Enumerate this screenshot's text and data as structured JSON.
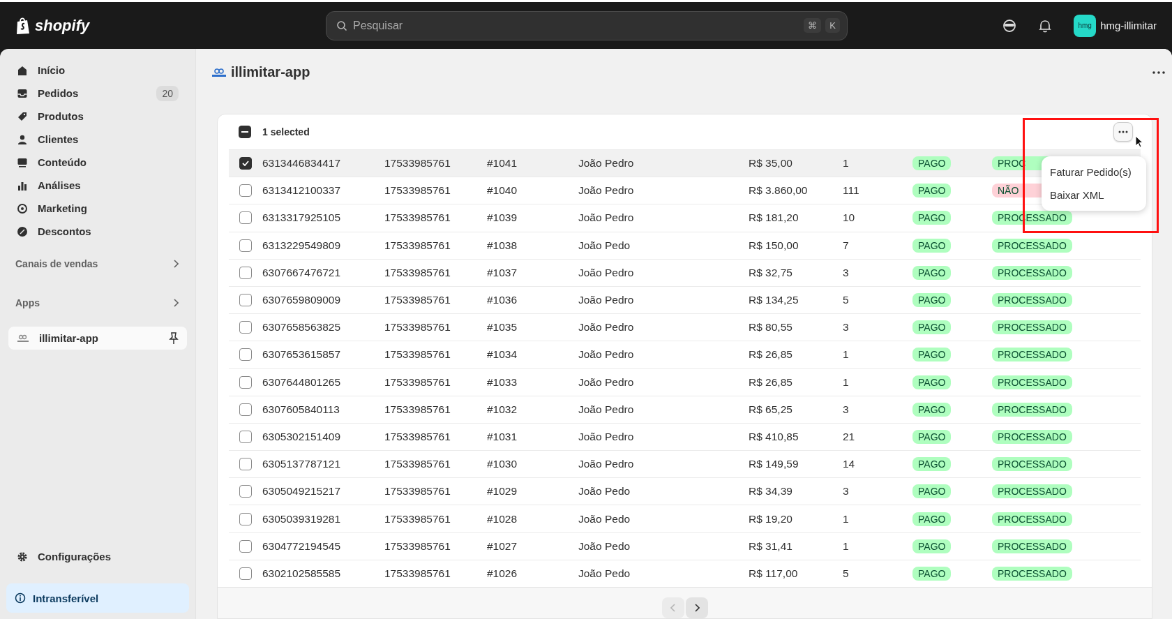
{
  "topbar": {
    "logo": "shopify",
    "search": {
      "placeholder": "Pesquisar",
      "keys": [
        "⌘",
        "K"
      ]
    },
    "account": {
      "avatar": "hmg",
      "name": "hmg-illimitar"
    }
  },
  "sidebar": {
    "items": [
      {
        "label": "Início",
        "selected": false
      },
      {
        "label": "Pedidos",
        "selected": false,
        "badge": "20"
      },
      {
        "label": "Produtos",
        "selected": false
      },
      {
        "label": "Clientes",
        "selected": false
      },
      {
        "label": "Conteúdo",
        "selected": false
      },
      {
        "label": "Análises",
        "selected": false
      },
      {
        "label": "Marketing",
        "selected": false
      },
      {
        "label": "Descontos",
        "selected": false
      }
    ],
    "sections": [
      {
        "label": "Canais de vendas"
      },
      {
        "label": "Apps",
        "items": [
          {
            "label": "illimitar-app",
            "selected": true,
            "pinned": true
          }
        ]
      }
    ],
    "settings": "Configurações",
    "notice": "Intransferível"
  },
  "page": {
    "title": "illimitar-app"
  },
  "table": {
    "bulk": {
      "label": "1 selected",
      "indeterminate": true
    },
    "menu": {
      "open": true,
      "items": [
        "Faturar Pedido(s)",
        "Baixar XML"
      ]
    },
    "rows": [
      {
        "selected": true,
        "id": "6313446834417",
        "column_2": "17533985761",
        "number": "#1041",
        "customer": "João Pedro",
        "total": "R$ 35,00",
        "column_6": "1",
        "payment": {
          "text": "PAGO",
          "color": "#affebf"
        },
        "status": {
          "text": "PROC",
          "color": "#affebf"
        }
      },
      {
        "selected": false,
        "id": "6313412100337",
        "column_2": "17533985761",
        "number": "#1040",
        "customer": "João Pedro",
        "total": "R$ 3.860,00",
        "column_6": "111",
        "payment": {
          "text": "PAGO",
          "color": "#affebf"
        },
        "status": {
          "text": "NÃO",
          "color": "#fed1d7"
        }
      },
      {
        "selected": false,
        "id": "6313317925105",
        "column_2": "17533985761",
        "number": "#1039",
        "customer": "João Pedro",
        "total": "R$ 181,20",
        "column_6": "10",
        "payment": {
          "text": "PAGO",
          "color": "#affebf"
        },
        "status": {
          "text": "PROCESSADO",
          "color": "#affebf"
        }
      },
      {
        "selected": false,
        "id": "6313229549809",
        "column_2": "17533985761",
        "number": "#1038",
        "customer": "João Pedo",
        "total": "R$ 150,00",
        "column_6": "7",
        "payment": {
          "text": "PAGO",
          "color": "#affebf"
        },
        "status": {
          "text": "PROCESSADO",
          "color": "#affebf"
        }
      },
      {
        "selected": false,
        "id": "6307667476721",
        "column_2": "17533985761",
        "number": "#1037",
        "customer": "João Pedro",
        "total": "R$ 32,75",
        "column_6": "3",
        "payment": {
          "text": "PAGO",
          "color": "#affebf"
        },
        "status": {
          "text": "PROCESSADO",
          "color": "#affebf"
        }
      },
      {
        "selected": false,
        "id": "6307659809009",
        "column_2": "17533985761",
        "number": "#1036",
        "customer": "João Pedro",
        "total": "R$ 134,25",
        "column_6": "5",
        "payment": {
          "text": "PAGO",
          "color": "#affebf"
        },
        "status": {
          "text": "PROCESSADO",
          "color": "#affebf"
        }
      },
      {
        "selected": false,
        "id": "6307658563825",
        "column_2": "17533985761",
        "number": "#1035",
        "customer": "João Pedro",
        "total": "R$ 80,55",
        "column_6": "3",
        "payment": {
          "text": "PAGO",
          "color": "#affebf"
        },
        "status": {
          "text": "PROCESSADO",
          "color": "#affebf"
        }
      },
      {
        "selected": false,
        "id": "6307653615857",
        "column_2": "17533985761",
        "number": "#1034",
        "customer": "João Pedro",
        "total": "R$ 26,85",
        "column_6": "1",
        "payment": {
          "text": "PAGO",
          "color": "#affebf"
        },
        "status": {
          "text": "PROCESSADO",
          "color": "#affebf"
        }
      },
      {
        "selected": false,
        "id": "6307644801265",
        "column_2": "17533985761",
        "number": "#1033",
        "customer": "João Pedro",
        "total": "R$ 26,85",
        "column_6": "1",
        "payment": {
          "text": "PAGO",
          "color": "#affebf"
        },
        "status": {
          "text": "PROCESSADO",
          "color": "#affebf"
        }
      },
      {
        "selected": false,
        "id": "6307605840113",
        "column_2": "17533985761",
        "number": "#1032",
        "customer": "João Pedro",
        "total": "R$ 65,25",
        "column_6": "3",
        "payment": {
          "text": "PAGO",
          "color": "#affebf"
        },
        "status": {
          "text": "PROCESSADO",
          "color": "#affebf"
        }
      },
      {
        "selected": false,
        "id": "6305302151409",
        "column_2": "17533985761",
        "number": "#1031",
        "customer": "João Pedro",
        "total": "R$ 410,85",
        "column_6": "21",
        "payment": {
          "text": "PAGO",
          "color": "#affebf"
        },
        "status": {
          "text": "PROCESSADO",
          "color": "#affebf"
        }
      },
      {
        "selected": false,
        "id": "6305137787121",
        "column_2": "17533985761",
        "number": "#1030",
        "customer": "João Pedro",
        "total": "R$ 149,59",
        "column_6": "14",
        "payment": {
          "text": "PAGO",
          "color": "#affebf"
        },
        "status": {
          "text": "PROCESSADO",
          "color": "#affebf"
        }
      },
      {
        "selected": false,
        "id": "6305049215217",
        "column_2": "17533985761",
        "number": "#1029",
        "customer": "João Pedo",
        "total": "R$ 34,39",
        "column_6": "3",
        "payment": {
          "text": "PAGO",
          "color": "#affebf"
        },
        "status": {
          "text": "PROCESSADO",
          "color": "#affebf"
        }
      },
      {
        "selected": false,
        "id": "6305039319281",
        "column_2": "17533985761",
        "number": "#1028",
        "customer": "João Pedo",
        "total": "R$ 19,20",
        "column_6": "1",
        "payment": {
          "text": "PAGO",
          "color": "#affebf"
        },
        "status": {
          "text": "PROCESSADO",
          "color": "#affebf"
        }
      },
      {
        "selected": false,
        "id": "6304772194545",
        "column_2": "17533985761",
        "number": "#1027",
        "customer": "João Pedo",
        "total": "R$ 31,41",
        "column_6": "1",
        "payment": {
          "text": "PAGO",
          "color": "#affebf"
        },
        "status": {
          "text": "PROCESSADO",
          "color": "#affebf"
        }
      },
      {
        "selected": false,
        "id": "6302102585585",
        "column_2": "17533985761",
        "number": "#1026",
        "customer": "João Pedo",
        "total": "R$ 117,00",
        "column_6": "5",
        "payment": {
          "text": "PAGO",
          "color": "#affebf"
        },
        "status": {
          "text": "PROCESSADO",
          "color": "#affebf"
        }
      }
    ],
    "pagination": {
      "previous_disabled": true,
      "next_disabled": false
    }
  }
}
